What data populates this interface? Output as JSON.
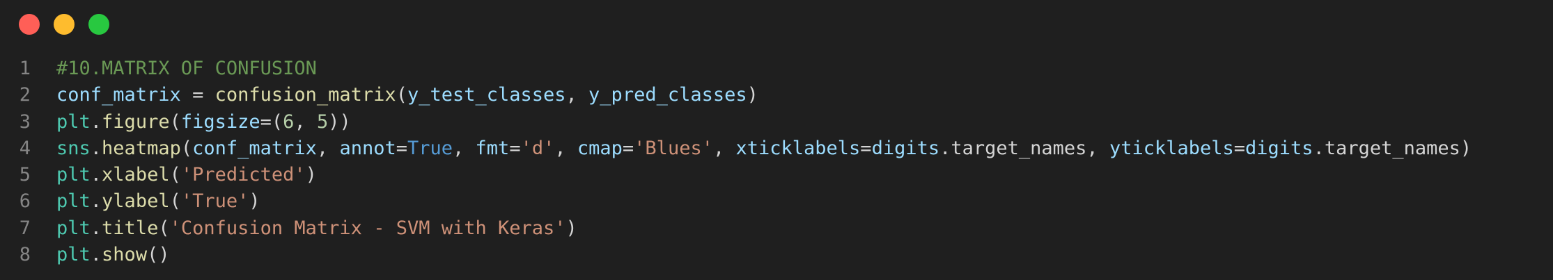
{
  "window": {
    "buttons": {
      "close_color": "#ff5f57",
      "minimize_color": "#febc2e",
      "maximize_color": "#28c840"
    }
  },
  "code": {
    "language": "python",
    "lines": [
      {
        "number": "1",
        "tokens": [
          {
            "t": "#10.MATRIX OF CONFUSION",
            "k": "comment"
          }
        ]
      },
      {
        "number": "2",
        "tokens": [
          {
            "t": "conf_matrix",
            "k": "var"
          },
          {
            "t": " = ",
            "k": "punct"
          },
          {
            "t": "confusion_matrix",
            "k": "func"
          },
          {
            "t": "(",
            "k": "punct"
          },
          {
            "t": "y_test_classes",
            "k": "var"
          },
          {
            "t": ", ",
            "k": "punct"
          },
          {
            "t": "y_pred_classes",
            "k": "var"
          },
          {
            "t": ")",
            "k": "punct"
          }
        ]
      },
      {
        "number": "3",
        "tokens": [
          {
            "t": "plt",
            "k": "mod"
          },
          {
            "t": ".",
            "k": "punct"
          },
          {
            "t": "figure",
            "k": "func"
          },
          {
            "t": "(",
            "k": "punct"
          },
          {
            "t": "figsize",
            "k": "param"
          },
          {
            "t": "=(",
            "k": "punct"
          },
          {
            "t": "6",
            "k": "num"
          },
          {
            "t": ", ",
            "k": "punct"
          },
          {
            "t": "5",
            "k": "num"
          },
          {
            "t": "))",
            "k": "punct"
          }
        ]
      },
      {
        "number": "4",
        "tokens": [
          {
            "t": "sns",
            "k": "mod"
          },
          {
            "t": ".",
            "k": "punct"
          },
          {
            "t": "heatmap",
            "k": "func"
          },
          {
            "t": "(",
            "k": "punct"
          },
          {
            "t": "conf_matrix",
            "k": "var"
          },
          {
            "t": ", ",
            "k": "punct"
          },
          {
            "t": "annot",
            "k": "param"
          },
          {
            "t": "=",
            "k": "punct"
          },
          {
            "t": "True",
            "k": "kw"
          },
          {
            "t": ", ",
            "k": "punct"
          },
          {
            "t": "fmt",
            "k": "param"
          },
          {
            "t": "=",
            "k": "punct"
          },
          {
            "t": "'d'",
            "k": "str"
          },
          {
            "t": ", ",
            "k": "punct"
          },
          {
            "t": "cmap",
            "k": "param"
          },
          {
            "t": "=",
            "k": "punct"
          },
          {
            "t": "'Blues'",
            "k": "str"
          },
          {
            "t": ", ",
            "k": "punct"
          },
          {
            "t": "xticklabels",
            "k": "param"
          },
          {
            "t": "=",
            "k": "punct"
          },
          {
            "t": "digits",
            "k": "var"
          },
          {
            "t": ".target_names, ",
            "k": "punct"
          },
          {
            "t": "yticklabels",
            "k": "param"
          },
          {
            "t": "=",
            "k": "punct"
          },
          {
            "t": "digits",
            "k": "var"
          },
          {
            "t": ".target_names)",
            "k": "punct"
          }
        ]
      },
      {
        "number": "5",
        "tokens": [
          {
            "t": "plt",
            "k": "mod"
          },
          {
            "t": ".",
            "k": "punct"
          },
          {
            "t": "xlabel",
            "k": "func"
          },
          {
            "t": "(",
            "k": "punct"
          },
          {
            "t": "'Predicted'",
            "k": "str"
          },
          {
            "t": ")",
            "k": "punct"
          }
        ]
      },
      {
        "number": "6",
        "tokens": [
          {
            "t": "plt",
            "k": "mod"
          },
          {
            "t": ".",
            "k": "punct"
          },
          {
            "t": "ylabel",
            "k": "func"
          },
          {
            "t": "(",
            "k": "punct"
          },
          {
            "t": "'True'",
            "k": "str"
          },
          {
            "t": ")",
            "k": "punct"
          }
        ]
      },
      {
        "number": "7",
        "tokens": [
          {
            "t": "plt",
            "k": "mod"
          },
          {
            "t": ".",
            "k": "punct"
          },
          {
            "t": "title",
            "k": "func"
          },
          {
            "t": "(",
            "k": "punct"
          },
          {
            "t": "'Confusion Matrix - SVM with Keras'",
            "k": "str"
          },
          {
            "t": ")",
            "k": "punct"
          }
        ]
      },
      {
        "number": "8",
        "tokens": [
          {
            "t": "plt",
            "k": "mod"
          },
          {
            "t": ".",
            "k": "punct"
          },
          {
            "t": "show",
            "k": "func"
          },
          {
            "t": "()",
            "k": "punct"
          }
        ]
      }
    ]
  }
}
